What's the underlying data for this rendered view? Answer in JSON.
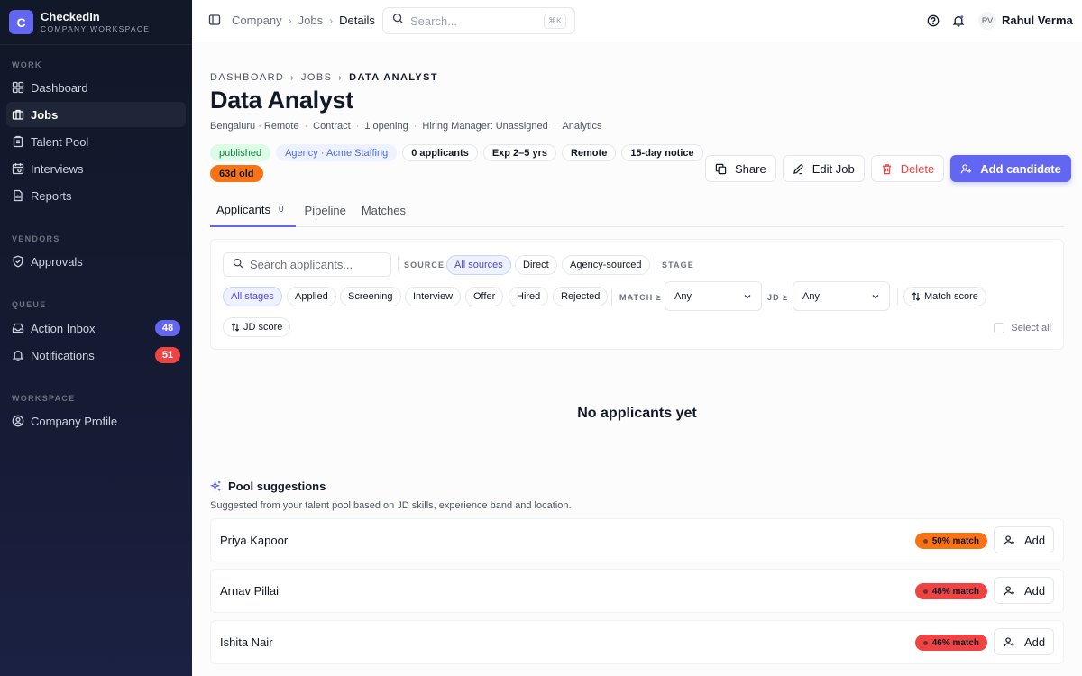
{
  "brand": {
    "logo_letter": "C",
    "name": "CheckedIn",
    "subtitle": "COMPANY WORKSPACE",
    "accent": "#6366f1"
  },
  "sidebar": {
    "sections": [
      {
        "label": "WORK",
        "items": [
          {
            "label": "Dashboard",
            "icon": "grid-icon"
          },
          {
            "label": "Jobs",
            "icon": "briefcase-icon",
            "active": true
          },
          {
            "label": "Talent Pool",
            "icon": "clipboard-icon"
          },
          {
            "label": "Interviews",
            "icon": "calendar-icon"
          },
          {
            "label": "Reports",
            "icon": "report-icon"
          }
        ]
      },
      {
        "label": "VENDORS",
        "items": [
          {
            "label": "Approvals",
            "icon": "shield-check-icon"
          }
        ]
      },
      {
        "label": "QUEUE",
        "items": [
          {
            "label": "Action Inbox",
            "icon": "inbox-icon",
            "badge": "48",
            "badge_color": "#6366f1"
          },
          {
            "label": "Notifications",
            "icon": "bell-icon",
            "badge": "51",
            "badge_color": "#ef4444"
          }
        ]
      },
      {
        "label": "WORKSPACE",
        "items": [
          {
            "label": "Company Profile",
            "icon": "user-circle-icon"
          }
        ]
      }
    ]
  },
  "topbar": {
    "breadcrumbs": [
      "Company",
      "Jobs",
      "Details"
    ],
    "search_placeholder": "Search...",
    "search_shortcut": "⌘K",
    "user_initials": "RV",
    "user_name": "Rahul Verma"
  },
  "job": {
    "breadcrumbs": [
      "DASHBOARD",
      "JOBS",
      "DATA ANALYST"
    ],
    "title": "Data Analyst",
    "meta": [
      "Bengaluru · Remote",
      "Contract",
      "1 opening",
      "Hiring Manager: Unassigned",
      "Analytics"
    ],
    "chips": [
      "published",
      "Agency · Acme Staffing",
      "0 applicants",
      "Exp 2–5 yrs",
      "Remote",
      "15-day notice"
    ],
    "age_chip": "63d old",
    "actions": {
      "share": "Share",
      "edit": "Edit Job",
      "delete": "Delete",
      "add_candidate": "Add candidate"
    }
  },
  "tabs": [
    {
      "label": "Applicants",
      "count": "0",
      "active": true
    },
    {
      "label": "Pipeline"
    },
    {
      "label": "Matches"
    }
  ],
  "filters": {
    "search_placeholder": "Search applicants...",
    "source_label": "SOURCE",
    "sources": [
      "All sources",
      "Direct",
      "Agency-sourced"
    ],
    "stage_label": "STAGE",
    "stages": [
      "All stages",
      "Applied",
      "Screening",
      "Interview",
      "Offer",
      "Hired",
      "Rejected"
    ],
    "match_label": "MATCH ≥",
    "match_value": "Any",
    "jd_label": "JD ≥",
    "jd_value": "Any",
    "sort_match": "Match score",
    "sort_jd": "JD score",
    "select_all": "Select all"
  },
  "empty_state": "No applicants yet",
  "pool": {
    "title": "Pool suggestions",
    "subtitle": "Suggested from your talent pool based on JD skills, experience band and location.",
    "add_label": "Add",
    "suggestions": [
      {
        "name": "Priya Kapoor",
        "match": "50% match",
        "color": "#f97316"
      },
      {
        "name": "Arnav Pillai",
        "match": "48% match",
        "color": "#ef4444"
      },
      {
        "name": "Ishita Nair",
        "match": "46% match",
        "color": "#ef4444"
      }
    ]
  }
}
